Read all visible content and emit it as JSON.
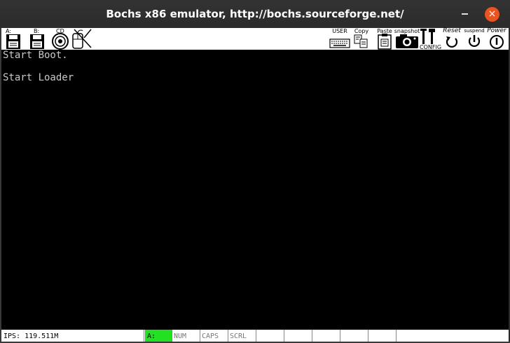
{
  "window": {
    "title": "Bochs x86 emulator, http://bochs.sourceforge.net/",
    "close_glyph": "×"
  },
  "toolbar": {
    "floppy_a_label": "A:",
    "floppy_b_label": "B:",
    "cdrom_label": "CD",
    "user_label": "USER",
    "copy_label": "Copy",
    "paste_label": "Paste",
    "snapshot_label": "snapshot",
    "config_label": "CONFIG",
    "reset_label": "Reset",
    "suspend_label": "suspend",
    "power_label": "Power",
    "icons": [
      "floppy-a-icon",
      "floppy-b-icon",
      "cdrom-icon",
      "mouse-icon",
      "keyboard-icon",
      "copy-icon",
      "paste-icon",
      "camera-icon",
      "config-icon",
      "reset-icon",
      "suspend-icon",
      "power-icon"
    ]
  },
  "console": {
    "lines": [
      "Start Boot.",
      "",
      "Start Loader"
    ]
  },
  "statusbar": {
    "ips": "IPS: 119.511M",
    "a_indicator": "A:",
    "num": "NUM",
    "caps": "CAPS",
    "scrl": "SCRL",
    "a_color": "#22e022"
  },
  "colors": {
    "titlebar": "#2b2b2b",
    "close_button": "#e95420",
    "screen": "#000000",
    "console_text": "#c8c8c8"
  }
}
